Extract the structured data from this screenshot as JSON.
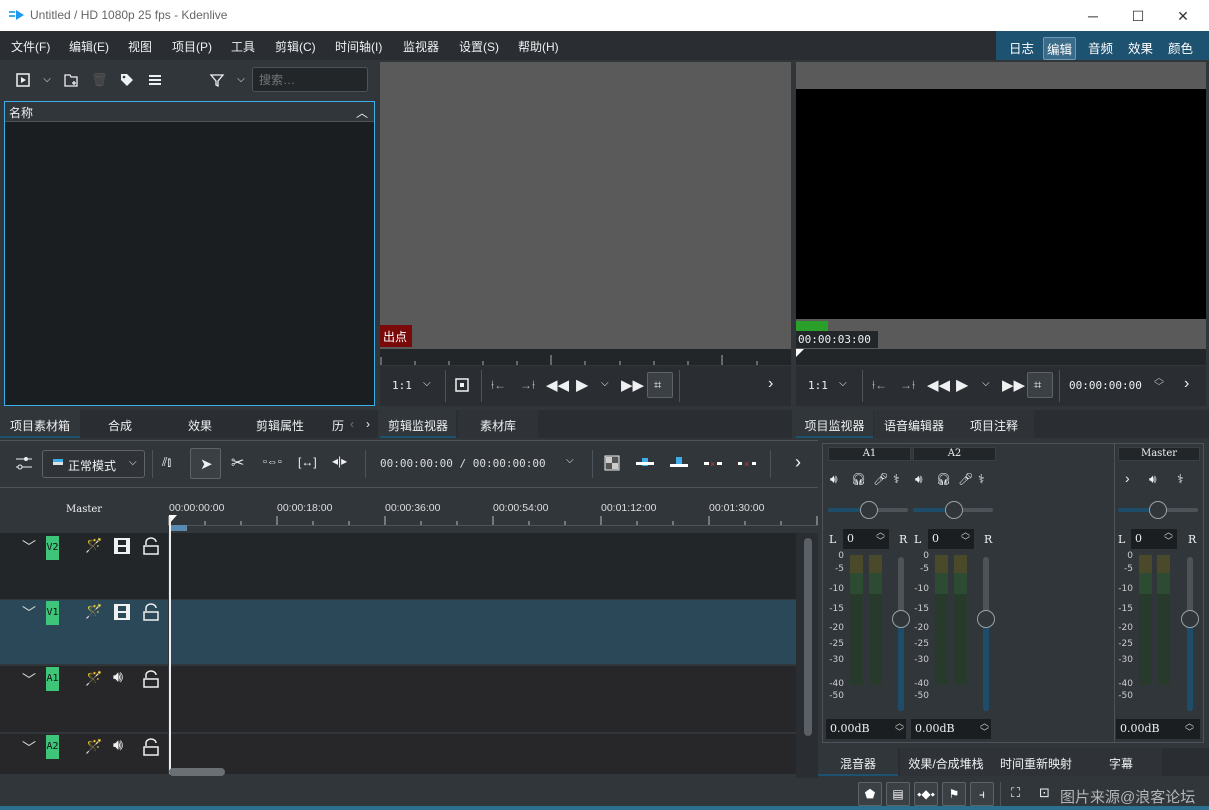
{
  "window": {
    "title": "Untitled / HD 1080p 25 fps - Kdenlive",
    "minimize_icon": "minimize-icon",
    "maximize_icon": "maximize-icon",
    "close_icon": "close-icon"
  },
  "menubar": {
    "items": [
      "文件(F)",
      "编辑(E)",
      "视图",
      "项目(P)",
      "工具",
      "剪辑(C)",
      "时间轴(I)",
      "监视器",
      "设置(S)",
      "帮助(H)"
    ]
  },
  "layouts": {
    "items": [
      "日志",
      "编辑",
      "音频",
      "效果",
      "颜色"
    ],
    "active": "编辑",
    "accent": "#1d5270"
  },
  "bin": {
    "search_placeholder": "搜索…",
    "column_header": "名称",
    "toolbar_icons": [
      "add-clip-icon",
      "dropdown-icon",
      "add-folder-icon",
      "delete-icon",
      "tag-icon",
      "menu-icon",
      "filter-icon",
      "filter-dropdown-icon"
    ]
  },
  "left_tabs": [
    "项目素材箱",
    "合成",
    "效果",
    "剪辑属性",
    "历"
  ],
  "clip_monitor": {
    "out_point_label": "出点",
    "zoom": "1:1",
    "tabs": [
      "剪辑监视器",
      "素材库"
    ]
  },
  "project_monitor": {
    "timecode_overlay": "00:00:03:00",
    "zoom": "1:1",
    "position": "00:00:00:00",
    "tabs": [
      "项目监视器",
      "语音编辑器",
      "项目注释"
    ]
  },
  "timeline_toolbar": {
    "mode": "正常模式",
    "timecode": "00:00:00:00 / 00:00:00:00"
  },
  "timeline": {
    "master_label": "Master",
    "ruler_ticks": [
      "00:00:00:00",
      "00:00:18:00",
      "00:00:36:00",
      "00:00:54:00",
      "00:01:12:00",
      "00:01:30:00"
    ],
    "tracks": [
      {
        "name": "V2",
        "type": "video",
        "selected": false
      },
      {
        "name": "V1",
        "type": "video",
        "selected": true
      },
      {
        "name": "A1",
        "type": "audio",
        "selected": false
      },
      {
        "name": "A2",
        "type": "audio",
        "selected": false
      }
    ]
  },
  "mixer": {
    "channels": [
      {
        "name": "A1",
        "pan": "0",
        "gain": "0.00dB",
        "fader_level": 0.62
      },
      {
        "name": "A2",
        "pan": "0",
        "gain": "0.00dB",
        "fader_level": 0.62
      },
      {
        "name": "Master",
        "pan": "0",
        "gain": "0.00dB",
        "fader_level": 0.62
      }
    ],
    "pan_left": "L",
    "pan_right": "R",
    "scale": [
      "0",
      "-5",
      "-10",
      "-15",
      "-20",
      "-25",
      "-30",
      "-40",
      "-50"
    ],
    "tabs": [
      "混音器",
      "效果/合成堆栈",
      "时间重新映射",
      "字幕"
    ]
  },
  "watermark": "图片来源@浪客论坛"
}
